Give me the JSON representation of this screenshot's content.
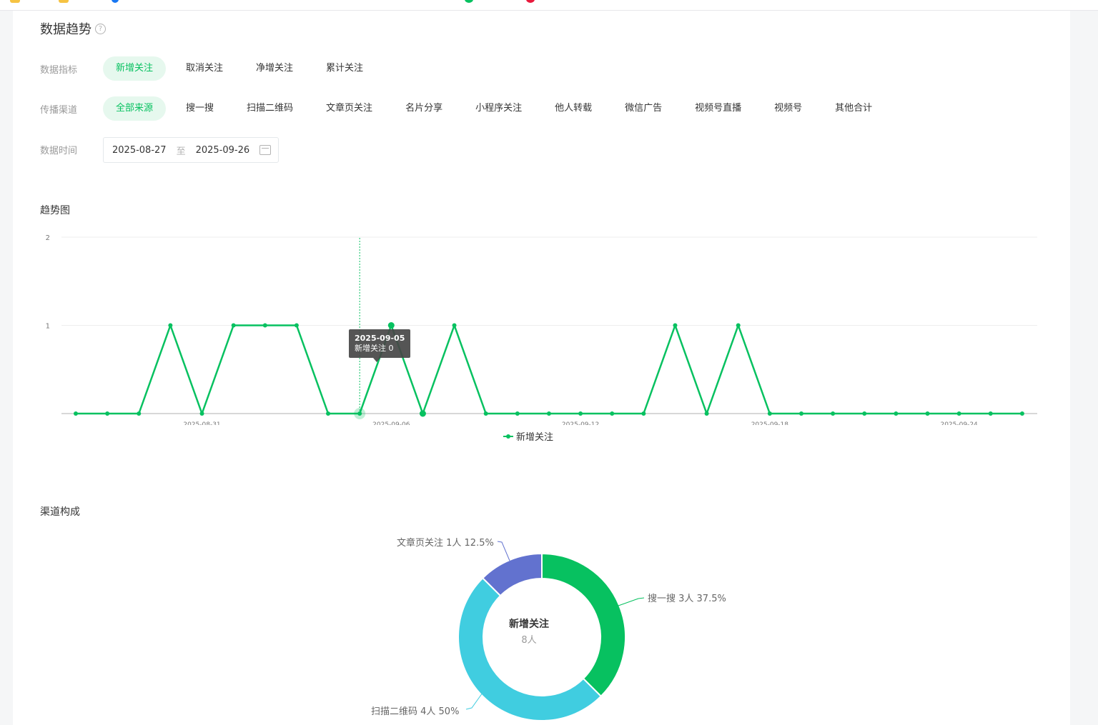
{
  "header": {
    "title": "数据趋势",
    "help_icon": "?"
  },
  "filters": {
    "metric": {
      "label": "数据指标",
      "options": [
        "新增关注",
        "取消关注",
        "净增关注",
        "累计关注"
      ],
      "selected": "新增关注"
    },
    "channel": {
      "label": "传播渠道",
      "options": [
        "全部来源",
        "搜一搜",
        "扫描二维码",
        "文章页关注",
        "名片分享",
        "小程序关注",
        "他人转载",
        "微信广告",
        "视频号直播",
        "视频号",
        "其他合计"
      ],
      "selected": "全部来源"
    },
    "date": {
      "label": "数据时间",
      "start": "2025-08-27",
      "separator": "至",
      "end": "2025-09-26"
    }
  },
  "trend": {
    "title": "趋势图",
    "tooltip": {
      "date": "2025-09-05",
      "text": "新增关注 0"
    },
    "legend": "新增关注"
  },
  "channel_mix": {
    "title": "渠道构成",
    "center_title": "新增关注",
    "center_sub": "8人",
    "labels": {
      "article": "文章页关注 1人 12.5%",
      "search": "搜一搜 3人 37.5%",
      "qrcode": "扫描二维码 4人 50%"
    }
  },
  "colors": {
    "accent": "#07c160",
    "qrcode": "#40cde0",
    "article": "#6272cf"
  },
  "chart_data": [
    {
      "type": "line",
      "x": [
        "2025-08-27",
        "2025-08-28",
        "2025-08-29",
        "2025-08-30",
        "2025-08-31",
        "2025-09-01",
        "2025-09-02",
        "2025-09-03",
        "2025-09-04",
        "2025-09-05",
        "2025-09-06",
        "2025-09-07",
        "2025-09-08",
        "2025-09-09",
        "2025-09-10",
        "2025-09-11",
        "2025-09-12",
        "2025-09-13",
        "2025-09-14",
        "2025-09-15",
        "2025-09-16",
        "2025-09-17",
        "2025-09-18",
        "2025-09-19",
        "2025-09-20",
        "2025-09-21",
        "2025-09-22",
        "2025-09-23",
        "2025-09-24",
        "2025-09-25",
        "2025-09-26"
      ],
      "series": [
        {
          "name": "新增关注",
          "values": [
            0,
            0,
            0,
            1,
            0,
            1,
            1,
            1,
            0,
            0,
            1,
            0,
            1,
            0,
            0,
            0,
            0,
            0,
            0,
            1,
            0,
            1,
            0,
            0,
            0,
            0,
            0,
            0,
            0,
            0,
            0
          ]
        }
      ],
      "x_tick_labels": [
        "2025-08-31",
        "2025-09-06",
        "2025-09-12",
        "2025-09-18",
        "2025-09-24"
      ],
      "y_tick_labels": [
        "1",
        "2"
      ],
      "ylim": [
        0,
        2
      ],
      "grid": true,
      "legend": "bottom-center"
    },
    {
      "type": "pie",
      "categories": [
        "搜一搜",
        "扫描二维码",
        "文章页关注"
      ],
      "values": [
        3,
        4,
        1
      ],
      "percent": [
        37.5,
        50,
        12.5
      ],
      "total": 8
    }
  ]
}
